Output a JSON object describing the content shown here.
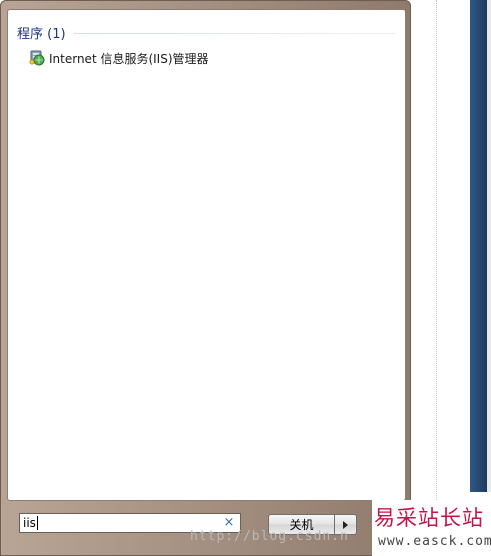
{
  "start_menu": {
    "group_title": "程序 (1)",
    "results": [
      {
        "label": "Internet 信息服务(IIS)管理器",
        "icon": "iis-manager-icon"
      }
    ],
    "search": {
      "value": "iis",
      "clear_symbol": "×"
    },
    "shutdown": {
      "label": "关机",
      "arrow_icon": "right-arrow-icon"
    }
  },
  "watermark": {
    "url": "http://blog.csdn.n",
    "brand": "易采站长站",
    "domain": "www.easck.com"
  },
  "colors": {
    "group_title": "#1e3287",
    "frame": "#a08b7d",
    "brand_watermark": "#c0174a",
    "desktop_bar": "#2f5a86"
  }
}
